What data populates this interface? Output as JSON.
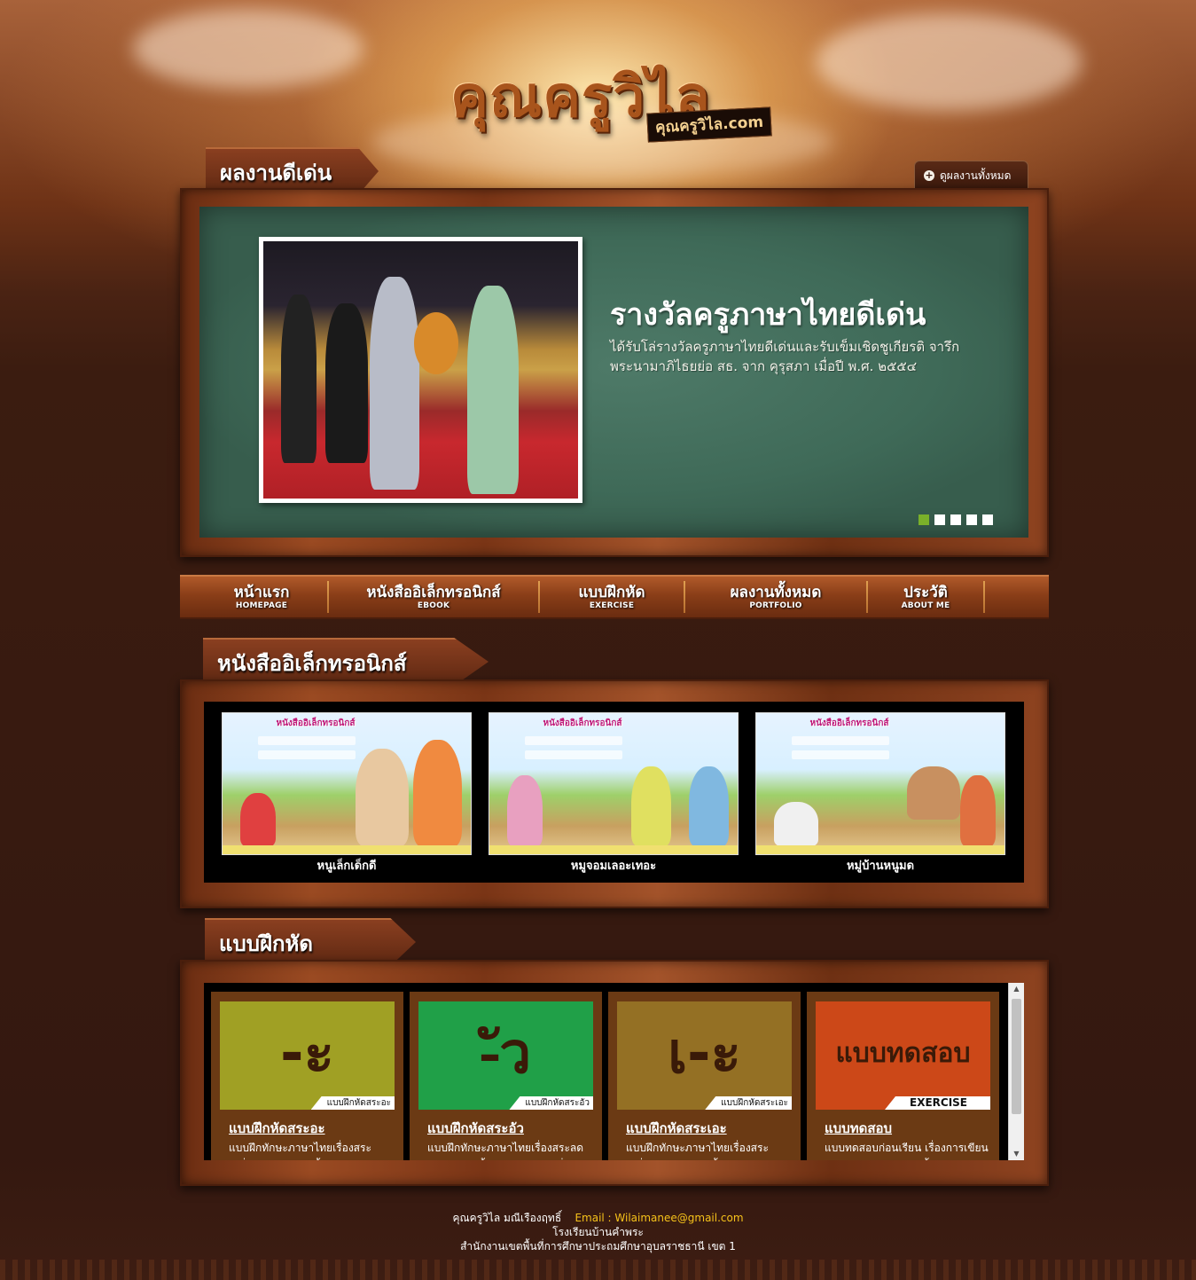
{
  "header": {
    "logo_main": "คุณครูวิไล",
    "logo_sub": "คุณครูวิไล.com"
  },
  "highlights": {
    "section_title": "ผลงานดีเด่น",
    "view_all_label": "ดูผลงานทั้งหมด",
    "slide": {
      "title": "รางวัลครูภาษาไทยดีเด่น",
      "description": "ได้รับโล่รางวัลครูภาษาไทยดีเด่นและรับเข็มเชิดชูเกียรติ จารึกพระนามาภิไธยย่อ สธ. จาก คุรุสภา เมื่อปี พ.ศ. ๒๕๕๔"
    },
    "slide_count": 5,
    "active_slide": 1
  },
  "nav": {
    "items": [
      {
        "th": "หน้าแรก",
        "en": "HOMEPAGE"
      },
      {
        "th": "หนังสืออิเล็กทรอนิกส์",
        "en": "EBOOK"
      },
      {
        "th": "แบบฝึกหัด",
        "en": "EXERCISE"
      },
      {
        "th": "ผลงานทั้งหมด",
        "en": "PORTFOLIO"
      },
      {
        "th": "ประวัติ",
        "en": "ABOUT ME"
      }
    ]
  },
  "ebooks": {
    "section_title": "หนังสืออิเล็กทรอนิกส์",
    "items": [
      {
        "caption": "หนูเล็กเด็กดี",
        "cover_title": "หนังสืออิเล็กทรอนิกส์"
      },
      {
        "caption": "หมูจอมเลอะเทอะ",
        "cover_title": "หนังสืออิเล็กทรอนิกส์"
      },
      {
        "caption": "หมู่บ้านหนูมด",
        "cover_title": "หนังสืออิเล็กทรอนิกส์"
      }
    ]
  },
  "exercises": {
    "section_title": "แบบฝึกหัด",
    "items": [
      {
        "glyph": "-ะ",
        "corner": "แบบฝึกหัดสระอะ",
        "title": "แบบฝึกหัดสระอะ",
        "desc": "แบบฝึกทักษะภาษาไทยเรื่องสระเปลี่ยนรูป สระ - ะ ชั้นประถมศึกษา",
        "color": "#a0a024"
      },
      {
        "glyph": "-ัว",
        "corner": "แบบฝึกหัดสระอัว",
        "title": "แบบฝึกหัดสระอัว",
        "desc": "แบบฝึกทักษะภาษาไทยเรื่องสระลดรูป สระ -ัว ชั้นประถมศึกษาปีที่",
        "color": "#20a048"
      },
      {
        "glyph": "เ-ะ",
        "corner": "แบบฝึกหัดสระเอะ",
        "title": "แบบฝึกหัดสระเอะ",
        "desc": "แบบฝึกทักษะภาษาไทยเรื่องสระเปลี่ยนรูป สระ เ-ะ ชั้นประถมศึกษา",
        "color": "#947024"
      },
      {
        "glyph": "แบบทดสอบ",
        "corner": "EXERCISE",
        "title": "แบบทดสอบ",
        "desc": "แบบทดสอบก่อนเรียน เรื่องการเขียนสะกดคำ สระอะ (-ะ) ชั้น",
        "color": "#cc4818"
      }
    ]
  },
  "footer": {
    "name": "คุณครูวิไล  มณีเรืองฤทธิ์",
    "email": "Email : Wilaimanee@gmail.com",
    "school": "โรงเรียนบ้านคำพระ",
    "office": "สำนักงานเขตพื้นที่การศึกษาประถมศึกษาอุบลราชธานี เขต 1"
  }
}
